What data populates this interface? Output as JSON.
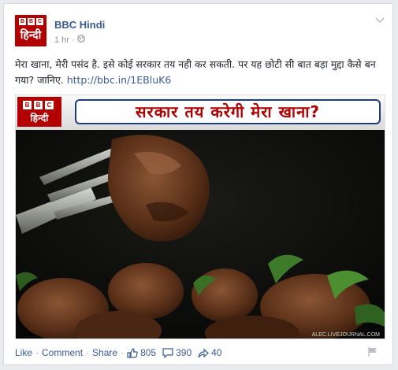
{
  "post": {
    "page_name": "BBC Hindi",
    "avatar_bbc_letters": [
      "B",
      "B",
      "C"
    ],
    "avatar_hindi_text": "हिन्दी",
    "time": "1 hr",
    "meta_separator": "·",
    "body_text": "मेरा खाना, मेरी पसंद है. इसे कोई सरकार तय नही कर सकती. पर यह छोटी सी बात बड़ा मुद्दा कैसे बन गया? जानिए. ",
    "link_text": "http://bbc.in/1EBluK6"
  },
  "media": {
    "banner_logo_letters": [
      "B",
      "B",
      "C"
    ],
    "banner_logo_hindi": "हिन्दी",
    "banner_title": "सरकार तय करेगी मेरा खाना?",
    "watermark": "ALEC.LIVEJOURNAL.COM"
  },
  "footer": {
    "like_label": "Like",
    "comment_label": "Comment",
    "share_label": "Share",
    "separator": "·",
    "likes_count": "805",
    "comments_count": "390",
    "shares_count": "40"
  },
  "colors": {
    "link_blue": "#3b5998",
    "bbc_red": "#b30000",
    "banner_title_red": "#b00000"
  },
  "icons": {
    "privacy": "globe-icon",
    "menu": "chevron-down-icon",
    "likes": "thumbs-up-icon",
    "comments": "comment-bubble-icon",
    "shares": "share-arrow-icon",
    "report": "flag-icon"
  }
}
